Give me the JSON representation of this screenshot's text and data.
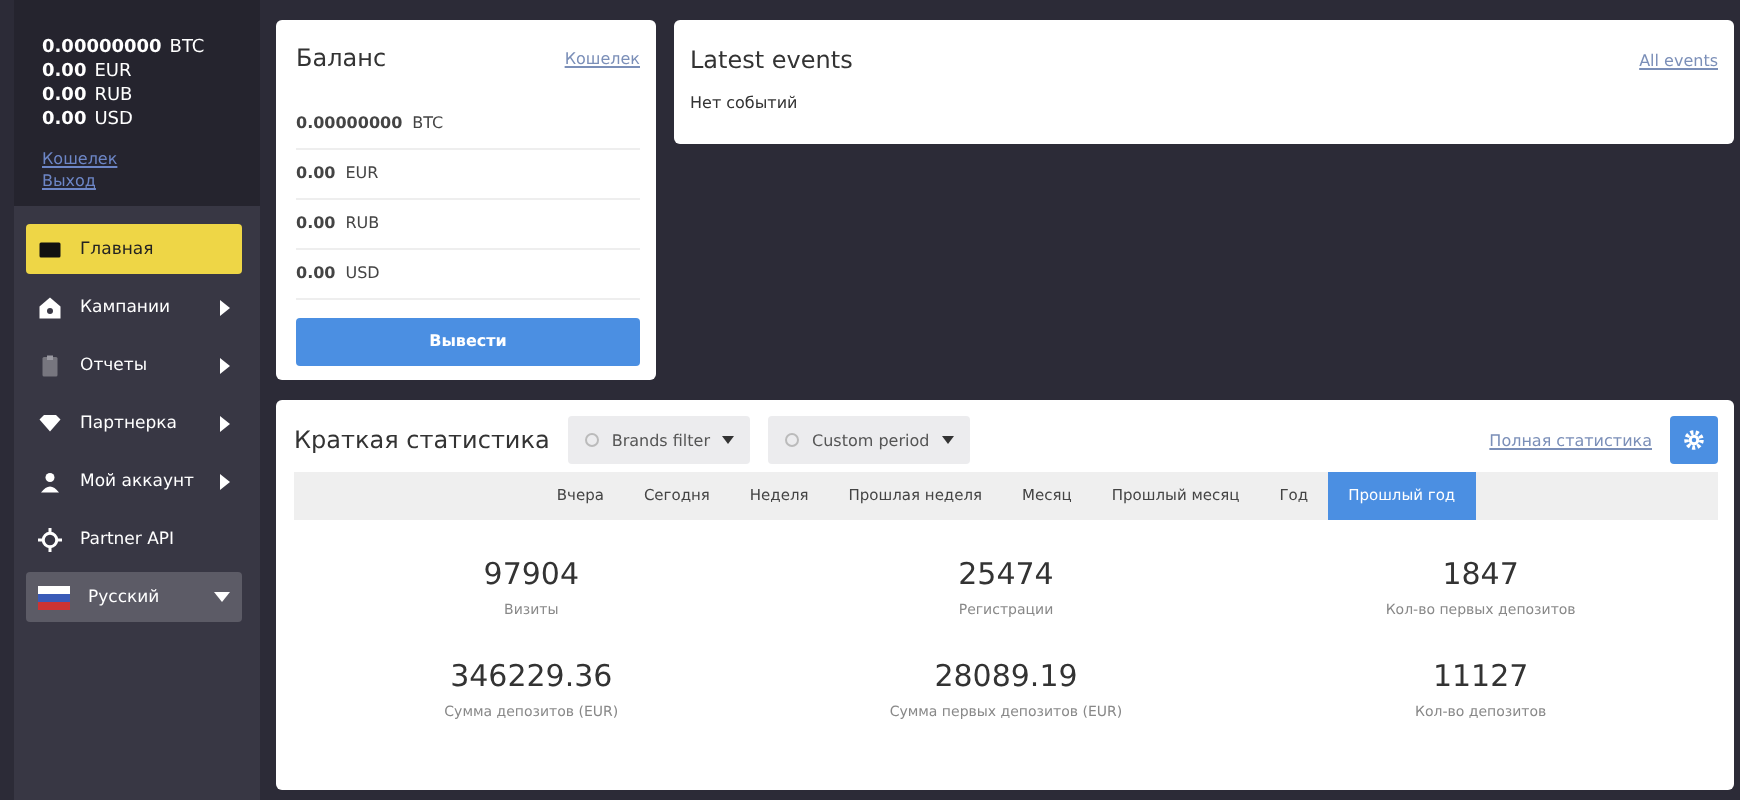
{
  "sidebar": {
    "balances": [
      {
        "amount": "0.00000000",
        "currency": "BTC"
      },
      {
        "amount": "0.00",
        "currency": "EUR"
      },
      {
        "amount": "0.00",
        "currency": "RUB"
      },
      {
        "amount": "0.00",
        "currency": "USD"
      }
    ],
    "links": [
      "Кошелек",
      "Выход"
    ],
    "menu": [
      {
        "label": "Главная",
        "selected": true,
        "has_submenu": false
      },
      {
        "label": "Кампании",
        "selected": false,
        "has_submenu": true
      },
      {
        "label": "Отчеты",
        "selected": false,
        "has_submenu": true
      },
      {
        "label": "Партнерка",
        "selected": false,
        "has_submenu": true
      },
      {
        "label": "Мой аккаунт",
        "selected": false,
        "has_submenu": true
      },
      {
        "label": "Partner API",
        "selected": false,
        "has_submenu": false
      }
    ],
    "language": "Русский"
  },
  "balance": {
    "title": "Баланс",
    "link": "Кошелек",
    "rows": [
      {
        "amount": "0.00000000",
        "currency": "BTC"
      },
      {
        "amount": "0.00",
        "currency": "EUR"
      },
      {
        "amount": "0.00",
        "currency": "RUB"
      },
      {
        "amount": "0.00",
        "currency": "USD"
      }
    ],
    "button": "Вывести"
  },
  "events": {
    "title": "Latest events",
    "link": "All events",
    "empty": "Нет событий"
  },
  "stats": {
    "title": "Краткая статистика",
    "filters": [
      "Brands filter",
      "Custom period"
    ],
    "link": "Полная статистика",
    "periods": [
      {
        "label": "Вчера",
        "selected": false
      },
      {
        "label": "Сегодня",
        "selected": false
      },
      {
        "label": "Неделя",
        "selected": false
      },
      {
        "label": "Прошлая неделя",
        "selected": false
      },
      {
        "label": "Месяц",
        "selected": false
      },
      {
        "label": "Прошлый месяц",
        "selected": false
      },
      {
        "label": "Год",
        "selected": false
      },
      {
        "label": "Прошлый год",
        "selected": true
      }
    ],
    "metrics": [
      {
        "value": "97904",
        "label": "Визиты"
      },
      {
        "value": "25474",
        "label": "Регистрации"
      },
      {
        "value": "1847",
        "label": "Кол-во первых депозитов"
      },
      {
        "value": "346229.36",
        "label": "Сумма депозитов (EUR)"
      },
      {
        "value": "28089.19",
        "label": "Сумма первых депозитов (EUR)"
      },
      {
        "value": "11127",
        "label": "Кол-во депозитов"
      }
    ]
  }
}
